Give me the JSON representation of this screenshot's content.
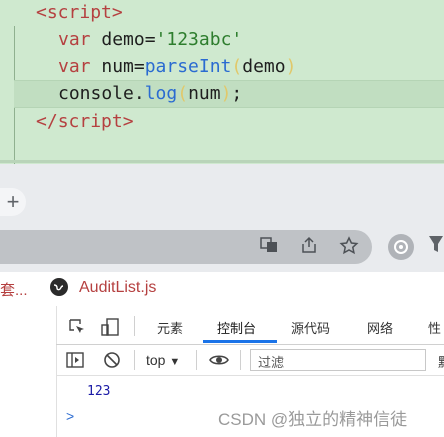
{
  "editor": {
    "open_tag_lt": "<",
    "open_tag_name": "script",
    "open_tag_gt": ">",
    "line1_kw": "var",
    "line1_rest": " demo=",
    "line1_str": "'123abc'",
    "line2_kw": "var",
    "line2_rest": " num=",
    "line2_fn": "parseInt",
    "line2_po": "(",
    "line2_arg": "demo",
    "line2_pc": ")",
    "line3_obj": "console.",
    "line3_fn": "log",
    "line3_po": "(",
    "line3_arg": "num",
    "line3_pc": ")",
    "line3_end": ";",
    "close_tag_lt": "</",
    "close_tag_name": "script",
    "close_tag_gt": ">"
  },
  "browser": {
    "new_tab": "+",
    "bookmark_1": "套...",
    "bookmark_2": "AuditList.js"
  },
  "devtools": {
    "tabs": [
      "元素",
      "控制台",
      "源代码",
      "网络",
      "性"
    ],
    "active_tab": "控制台",
    "context": "top",
    "context_arrow": "▼",
    "filter_placeholder": "过滤",
    "filter_right": "默",
    "console_output": "123",
    "prompt": ">"
  },
  "watermark": "CSDN @独立的精神信徒",
  "colors": {
    "editor_bg": "#cfe9cf",
    "tag": "#b54040",
    "string": "#2d7d2d",
    "function": "#2a6bd1",
    "active_tab_underline": "#1a73e8"
  }
}
